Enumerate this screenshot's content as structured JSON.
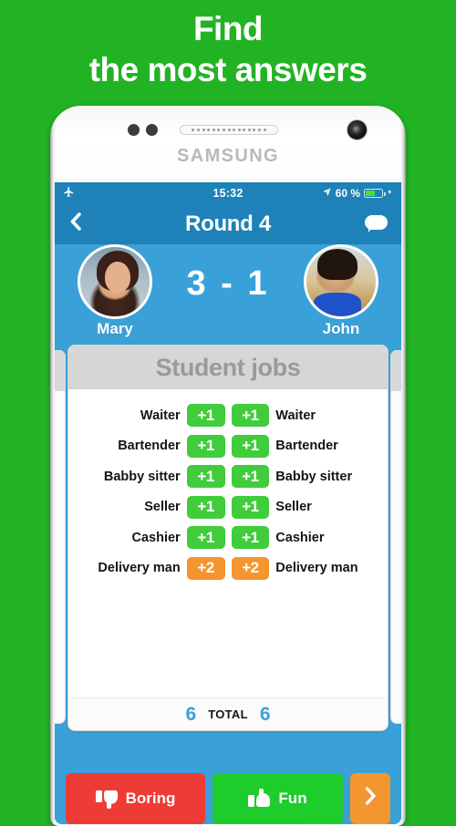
{
  "promo": {
    "line1": "Find",
    "line2": "the most answers"
  },
  "device": {
    "brand": "SAMSUNG"
  },
  "status_bar": {
    "airplane_icon": "airplane-icon",
    "clock": "15:32",
    "location_icon": "location-arrow-icon",
    "battery_percent": "60 %",
    "battery_level": 60,
    "charging_icon": "charging-bolt-icon"
  },
  "navbar": {
    "back_icon": "chevron-left-icon",
    "title": "Round 4",
    "chat_icon": "chat-bubble-icon"
  },
  "players": {
    "left": {
      "name": "Mary",
      "avatar": "avatar-mary"
    },
    "right": {
      "name": "John",
      "avatar": "avatar-john"
    },
    "score": "3 - 1",
    "score_left": 3,
    "score_right": 1
  },
  "card": {
    "title": "Student jobs",
    "rows": [
      {
        "left_label": "Waiter",
        "left_points": "+1",
        "left_color": "green",
        "right_points": "+1",
        "right_color": "green",
        "right_label": "Waiter"
      },
      {
        "left_label": "Bartender",
        "left_points": "+1",
        "left_color": "green",
        "right_points": "+1",
        "right_color": "green",
        "right_label": "Bartender"
      },
      {
        "left_label": "Babby sitter",
        "left_points": "+1",
        "left_color": "green",
        "right_points": "+1",
        "right_color": "green",
        "right_label": "Babby sitter"
      },
      {
        "left_label": "Seller",
        "left_points": "+1",
        "left_color": "green",
        "right_points": "+1",
        "right_color": "green",
        "right_label": "Seller"
      },
      {
        "left_label": "Cashier",
        "left_points": "+1",
        "left_color": "green",
        "right_points": "+1",
        "right_color": "green",
        "right_label": "Cashier"
      },
      {
        "left_label": "Delivery man",
        "left_points": "+2",
        "left_color": "orange",
        "right_points": "+2",
        "right_color": "orange",
        "right_label": "Delivery man"
      }
    ],
    "total_left": "6",
    "total_label": "TOTAL",
    "total_right": "6"
  },
  "actions": {
    "boring_label": "Boring",
    "boring_icon": "thumbs-down-icon",
    "fun_label": "Fun",
    "fun_icon": "thumbs-up-icon",
    "next_label": "›",
    "next_icon": "chevron-right-icon"
  },
  "colors": {
    "background_green": "#22b324",
    "header_blue": "#1e82b8",
    "app_blue": "#3aa0d8",
    "pill_green": "#41cc3c",
    "pill_orange": "#f3962f",
    "boring_red": "#ef3b35",
    "fun_green": "#1ecc2c"
  }
}
